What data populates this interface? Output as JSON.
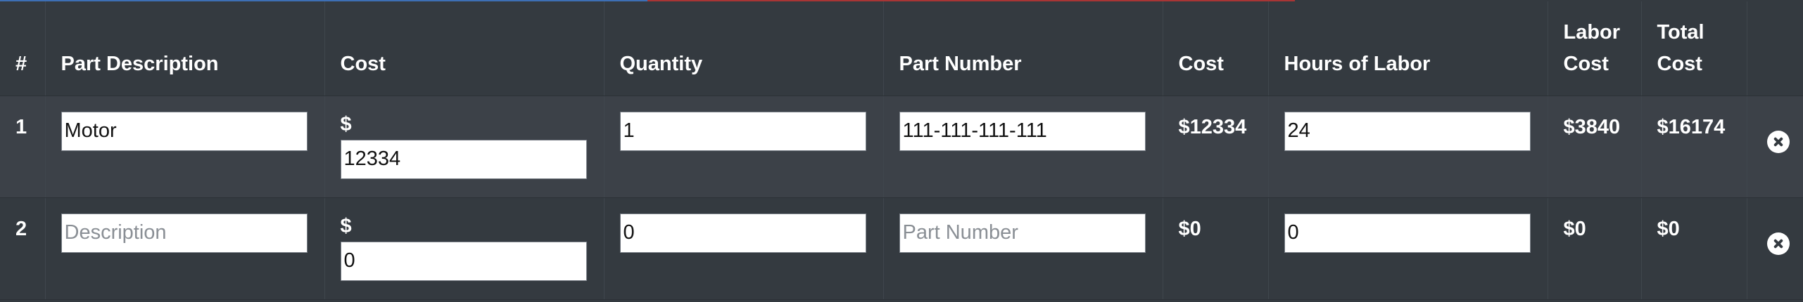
{
  "colors": {
    "background": "#343a40",
    "row_alt": "#3c4148",
    "accent_blue": "#3d6fb5",
    "accent_red": "#a83535"
  },
  "table": {
    "headers": {
      "num": "#",
      "part_description": "Part Description",
      "cost": "Cost",
      "quantity": "Quantity",
      "part_number": "Part Number",
      "cost_total": "Cost",
      "hours_of_labor": "Hours of Labor",
      "labor_cost_line1": "Labor",
      "labor_cost_line2": "Cost",
      "total_cost_line1": "Total",
      "total_cost_line2": "Cost"
    },
    "rows": [
      {
        "num": "1",
        "description": "Motor",
        "description_placeholder": "Description",
        "cost_symbol": "$",
        "cost": "12334",
        "quantity": "1",
        "part_number": "111-111-111-111",
        "part_number_placeholder": "Part Number",
        "cost_total": "$12334",
        "hours": "24",
        "labor_cost": "$3840",
        "total_cost": "$16174",
        "remove_icon": "circle-x-icon"
      },
      {
        "num": "2",
        "description": "",
        "description_placeholder": "Description",
        "cost_symbol": "$",
        "cost": "0",
        "quantity": "0",
        "part_number": "",
        "part_number_placeholder": "Part Number",
        "cost_total": "$0",
        "hours": "0",
        "labor_cost": "$0",
        "total_cost": "$0",
        "remove_icon": "circle-x-icon"
      }
    ]
  }
}
